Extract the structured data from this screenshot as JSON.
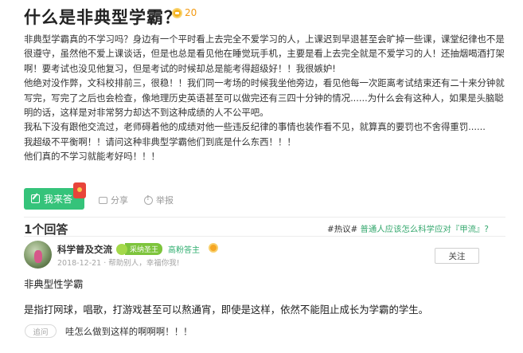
{
  "question": {
    "title": "什么是非典型学霸？",
    "bounty": "20",
    "body": [
      "非典型学霸真的不学习吗？身边有一个平时看上去完全不爱学习的人，上课迟到早退甚至会旷掉一些课，课堂纪律也不是很遵守，虽然他不爱上课谈话，但是也总是看见他在睡觉玩手机，主要是看上去完全就是不爱学习的人！还抽烟喝酒打架啊！要考试也没见他复习，但是考试的时候却总是能考得超级好！！我很嫉妒!",
      "他绝对没作弊，文科校排前三，很稳！！我们同一考场的时候我坐他旁边，看见他每一次距离考试结束还有二十来分钟就写完，写完了之后也会检查，像地理历史英语甚至可以做完还有三四十分钟的情况......为什么会有这种人，如果是头脑聪明的话，这样是对非常努力却达不到这种成绩的人不公平吧。",
      "我私下没有跟他交流过，老师碍着他的成绩对他一些违反纪律的事情也装作看不见，就算真的要罚也不舍得重罚......",
      "我超级不平衡啊！！请问这种非典型学霸他们到底是什么东西！！！",
      "他们真的不学习就能考好吗！！！"
    ],
    "answer_button": "我来答",
    "share": "分享",
    "report": "举报"
  },
  "answers_header": {
    "count": "1个回答",
    "topic_prefix": "#热议#",
    "topic_link": "普通人应该怎么科学应对『甲流』?"
  },
  "answer": {
    "username": "科学普及交流",
    "level_badge": "采纳数：2",
    "level_text": "采纳圣王",
    "rank": "高粉答主",
    "meta": "2018-12-21 · 帮助别人，幸福你我!",
    "follow": "关注",
    "line1": "非典型性学霸",
    "line2": "是指打网球，唱歌，打游戏甚至可以熬通宵，即使是这样，依然不能阻止成长为学霸的学生。",
    "followup_tag": "追问",
    "followup_text": "哇怎么做到这样的啊啊啊！！！"
  },
  "colors": {
    "accent_green": "#35c37a",
    "bounty_orange": "#f39a12",
    "link_green": "#35a86e"
  }
}
